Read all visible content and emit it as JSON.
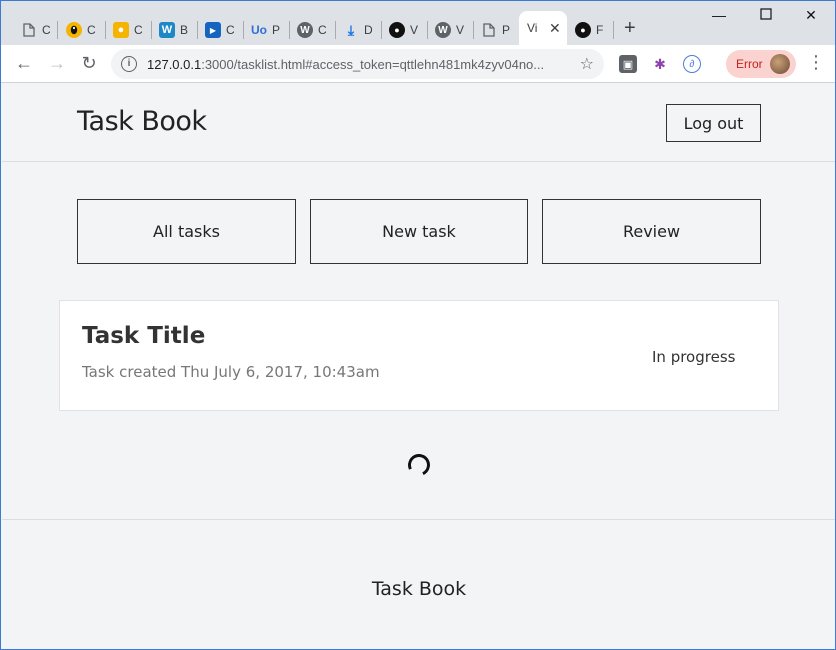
{
  "browser": {
    "tabs": [
      {
        "icon": "page-icon",
        "title": "C"
      },
      {
        "icon": "linux-icon",
        "title": "C"
      },
      {
        "icon": "bulb-icon",
        "title": "C",
        "color": "#f4b400"
      },
      {
        "icon": "w-icon",
        "title": "B",
        "color": "#1e88c7"
      },
      {
        "icon": "play-icon",
        "title": "C",
        "color": "#1565c0"
      },
      {
        "icon": "uo-icon",
        "title": "P",
        "color": "#2f6fd6"
      },
      {
        "icon": "wordpress-icon",
        "title": "C"
      },
      {
        "icon": "download-icon",
        "title": "D",
        "color": "#1a73e8"
      },
      {
        "icon": "github-icon",
        "title": "V"
      },
      {
        "icon": "wordpress-icon",
        "title": "V"
      },
      {
        "icon": "page-icon",
        "title": "P"
      },
      {
        "icon": "none",
        "title": "Vi",
        "active": true
      },
      {
        "icon": "github-icon",
        "title": "F"
      }
    ],
    "url_host": "127.0.0.1",
    "url_rest": ":3000/tasklist.html#access_token=qttlehn481mk4zyv04no...",
    "error_label": "Error"
  },
  "app": {
    "title": "Task Book",
    "logout_label": "Log out",
    "nav": {
      "all_tasks": "All tasks",
      "new_task": "New task",
      "review": "Review"
    },
    "task": {
      "title": "Task Title",
      "created": "Task created Thu July 6, 2017, 10:43am",
      "status": "In progress"
    },
    "footer": "Task Book"
  }
}
